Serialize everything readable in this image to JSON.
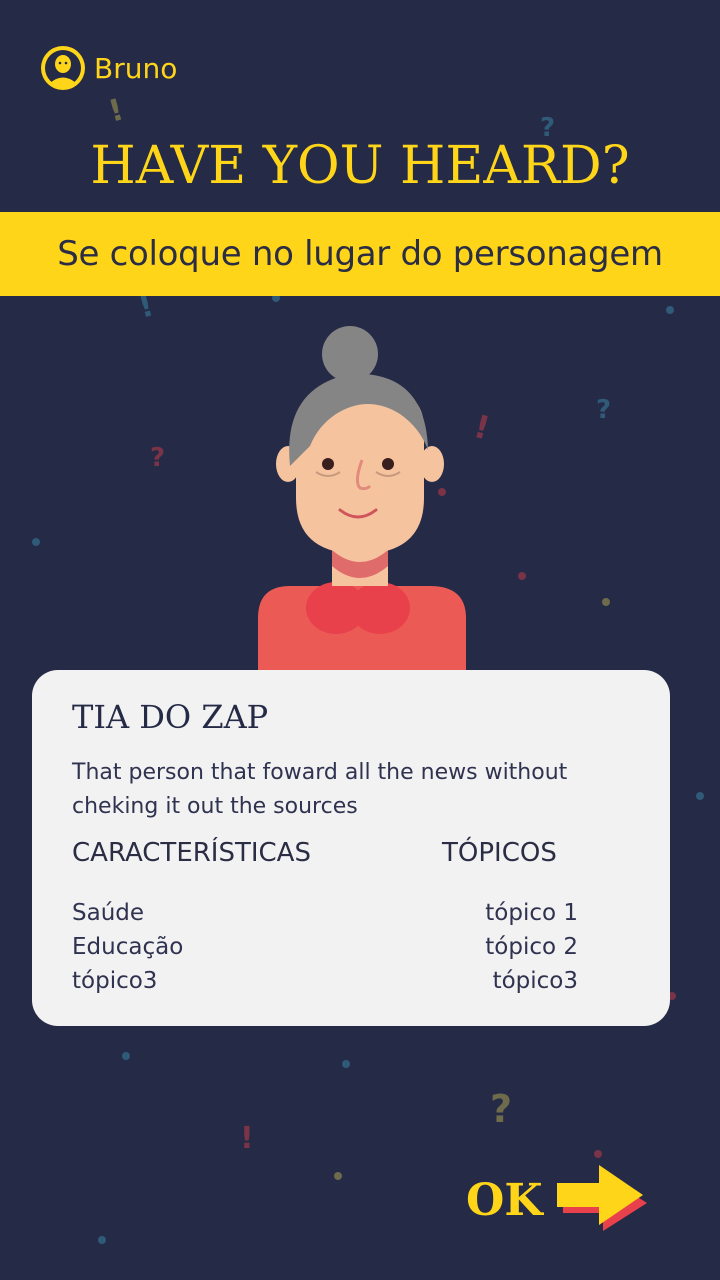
{
  "user": {
    "name": "Bruno"
  },
  "header": {
    "title": "HAVE YOU HEARD?",
    "subtitle": "Se coloque no lugar do personagem"
  },
  "card": {
    "name": "TIA DO ZAP",
    "description": "That person that foward all the news without cheking it out the sources",
    "characteristics_heading": "CARACTERÍSTICAS",
    "topics_heading": "TÓPICOS",
    "characteristics": [
      "Saúde",
      "Educação",
      "tópico3"
    ],
    "topics": [
      "tópico 1",
      "tópico 2",
      "tópico3"
    ]
  },
  "actions": {
    "ok_label": "OK"
  },
  "colors": {
    "background": "#252a47",
    "accent_yellow": "#ffd519",
    "accent_red": "#e8414b",
    "card": "#f2f2f2"
  },
  "icons": [
    "user-avatar-icon",
    "arrow-right-icon"
  ]
}
